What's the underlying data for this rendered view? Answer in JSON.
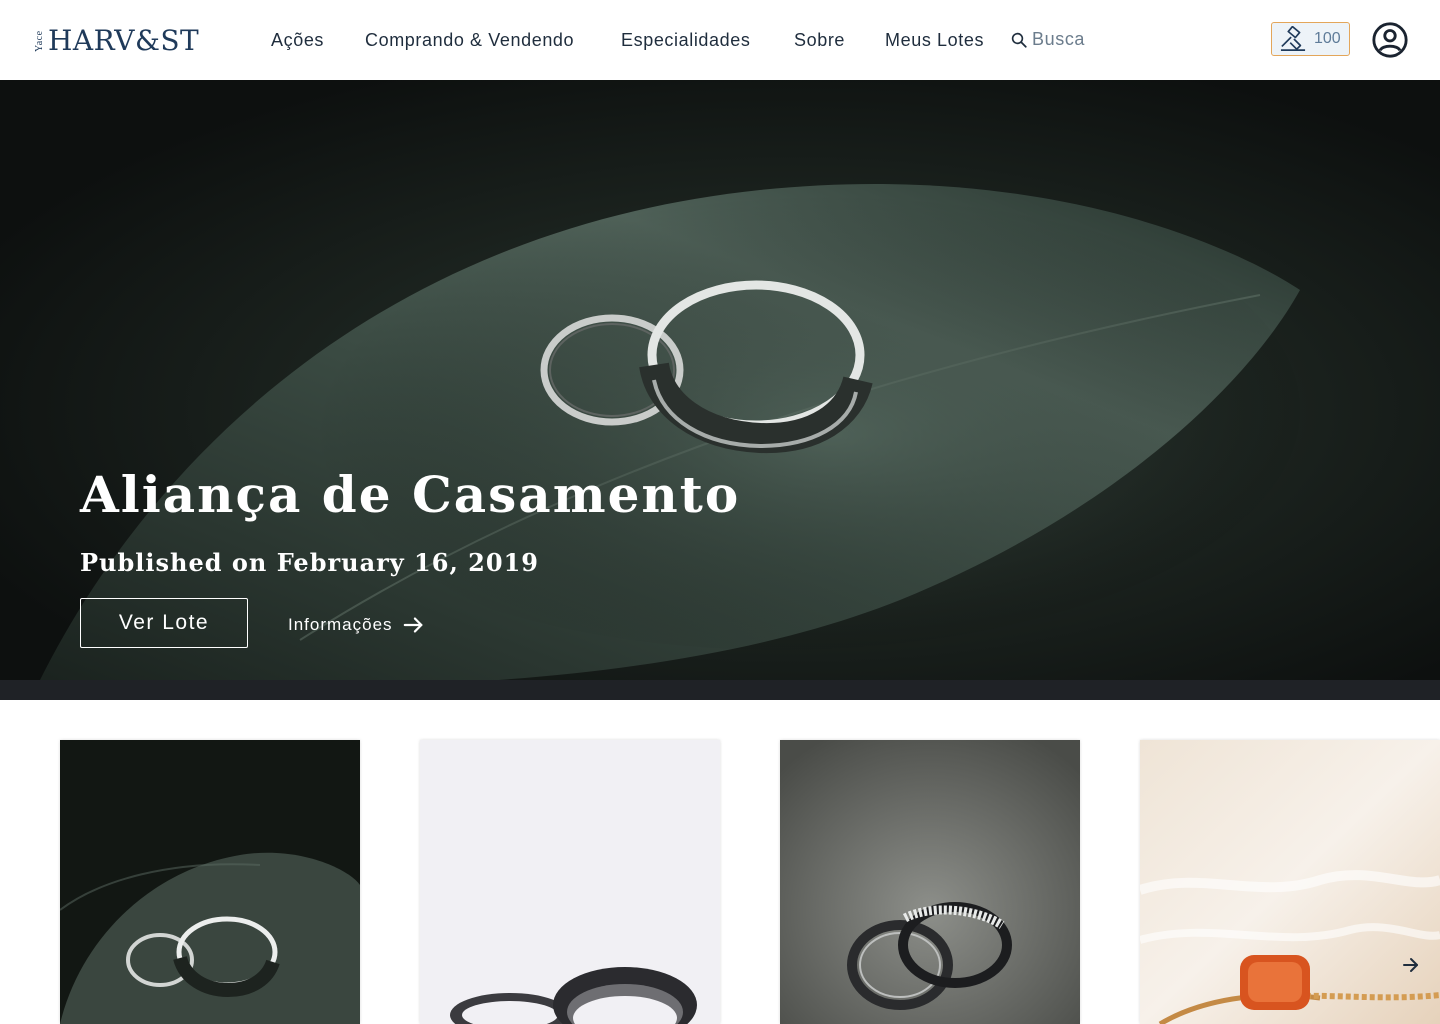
{
  "header": {
    "logo_sub": "Yace",
    "logo_main": "HARV&ST",
    "nav": [
      {
        "label": "Ações"
      },
      {
        "label": "Comprando & Vendendo"
      },
      {
        "label": "Especialidades"
      },
      {
        "label": "Sobre"
      },
      {
        "label": "Meus Lotes"
      }
    ],
    "search": {
      "label": "Busca",
      "icon": "search-icon"
    },
    "bid_badge": {
      "count": "100",
      "icon": "gavel-icon"
    },
    "avatar_icon": "user-circle-icon"
  },
  "hero": {
    "title": "Aliança de Casamento",
    "published": "Published on February 16, 2019",
    "primary_button": "Ver Lote",
    "info_link": "Informações",
    "info_icon": "arrow-right-icon"
  },
  "colors": {
    "brand": "#1f3a5a",
    "badge_border": "#e3a65a",
    "band": "#1f2226"
  },
  "cards": [
    {
      "image": "wedding-rings-on-leaf"
    },
    {
      "image": "dark-metal-rings-on-white"
    },
    {
      "image": "diamond-band-rings-on-stone"
    },
    {
      "image": "orange-gem-ring-on-fabric"
    }
  ],
  "carousel": {
    "next_icon": "chevron-right-icon"
  }
}
